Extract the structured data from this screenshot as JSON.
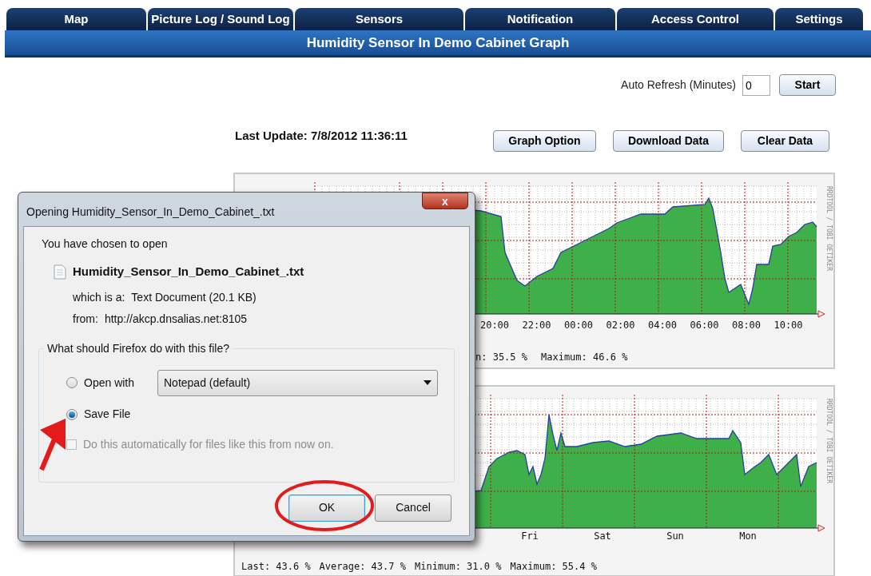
{
  "nav_tabs": [
    {
      "label": "Map"
    },
    {
      "label": "Picture Log / Sound Log"
    },
    {
      "label": "Sensors"
    },
    {
      "label": "Notification"
    },
    {
      "label": "Access Control"
    },
    {
      "label": "Settings"
    }
  ],
  "page_title": "Humidity Sensor In Demo Cabinet Graph",
  "auto_refresh": {
    "label": "Auto Refresh (Minutes)",
    "value": "0",
    "button": "Start"
  },
  "last_update": "Last Update: 7/8/2012 11:36:11",
  "graph_buttons": [
    "Graph Option",
    "Download Data",
    "Clear Data"
  ],
  "graphs": [
    {
      "credit": "RRDTOOL / TOBI OETIKER",
      "x_labels": [
        "20:00",
        "22:00",
        "00:00",
        "02:00",
        "04:00",
        "06:00",
        "08:00",
        "10:00"
      ],
      "summary": [
        "n: 35.5 %",
        "Maximum: 46.6 %"
      ]
    },
    {
      "credit": "RRDTOOL / TOBI OETIKER",
      "x_labels": [
        "Fri",
        "Sat",
        "Sun",
        "Mon"
      ],
      "summary": [
        "Last: 43.6 %",
        "Average: 43.7 %",
        "Minimum: 31.0 %",
        "Maximum: 55.4 %"
      ]
    }
  ],
  "dialog": {
    "title": "Opening Humidity_Sensor_In_Demo_Cabinet_.txt",
    "close": "x",
    "intro": "You have chosen to open",
    "file_name": "Humidity_Sensor_In_Demo_Cabinet_.txt",
    "type_label": "which is a:",
    "type_value": "Text Document (20.1 KB)",
    "from_label": "from:",
    "from_value": "http://akcp.dnsalias.net:8105",
    "question": "What should Firefox do with this file?",
    "options": [
      {
        "label": "Open with",
        "selected": false
      },
      {
        "label": "Save File",
        "selected": true
      }
    ],
    "app_select": "Notepad (default)",
    "auto_checkbox": {
      "label": "Do this automatically for files like this from now on.",
      "checked": false,
      "disabled": true
    },
    "buttons": [
      "OK",
      "Cancel"
    ]
  }
}
